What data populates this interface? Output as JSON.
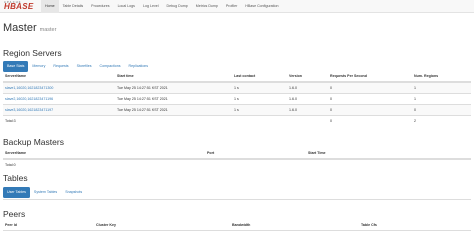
{
  "logo": {
    "top_text": "APACHE",
    "main_text": "HBASE"
  },
  "nav": [
    "Home",
    "Table Details",
    "Procedures",
    "Local Logs",
    "Log Level",
    "Debug Dump",
    "Metrics Dump",
    "Profiler",
    "HBase Configuration"
  ],
  "page": {
    "title": "Master",
    "subtitle": "master"
  },
  "region_servers": {
    "heading": "Region Servers",
    "tabs": [
      "Base Stats",
      "Memory",
      "Requests",
      "Storefiles",
      "Compactions",
      "Replications"
    ],
    "columns": [
      "ServerName",
      "Start time",
      "Last contact",
      "Version",
      "Requests Per Second",
      "Num. Regions"
    ],
    "rows": [
      [
        "slave1,16020,1621823471300",
        "Tue May 25 14:27:51 KST 2021",
        "1 s",
        "1.6.0",
        "0",
        "1"
      ],
      [
        "slave2,16020,1621823471196",
        "Tue May 25 14:27:51 KST 2021",
        "1 s",
        "1.6.0",
        "0",
        "1"
      ],
      [
        "slave3,16020,1621823471197",
        "Tue May 25 14:27:51 KST 2021",
        "1 s",
        "1.6.0",
        "0",
        "0"
      ]
    ],
    "total": [
      "Total:3",
      "",
      "",
      "",
      "0",
      "2"
    ]
  },
  "backup_masters": {
    "heading": "Backup Masters",
    "columns": [
      "ServerName",
      "Port",
      "Start Time"
    ],
    "total": "Total:0"
  },
  "tables": {
    "heading": "Tables",
    "tabs": [
      "User Tables",
      "System Tables",
      "Snapshots"
    ]
  },
  "peers": {
    "heading": "Peers",
    "columns": [
      "Peer Id",
      "Cluster Key",
      "Bandwidth",
      "Table Cfs"
    ]
  },
  "colors": {
    "link": "#337ab7",
    "logo": "#c0392b",
    "active_tab": "#337ab7"
  }
}
